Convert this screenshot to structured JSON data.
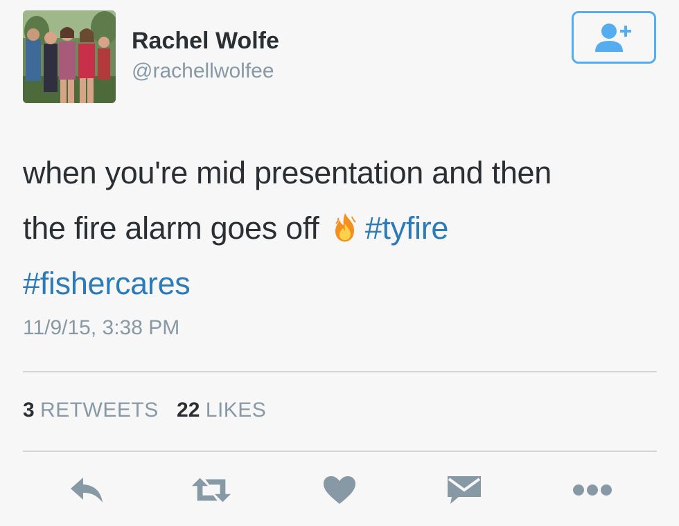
{
  "user": {
    "display_name": "Rachel Wolfe",
    "handle": "@rachellwolfee"
  },
  "follow_button": {
    "icon": "add-user-icon"
  },
  "tweet": {
    "text_line1": "when you're mid presentation and then",
    "text_line2_prefix": "the fire alarm goes off",
    "emoji": "fire-icon",
    "hashtag1": "#tyfire",
    "hashtag2": "#fishercares",
    "timestamp": "11/9/15, 3:38 PM"
  },
  "stats": {
    "retweets_count": "3",
    "retweets_label": "RETWEETS",
    "likes_count": "22",
    "likes_label": "LIKES"
  },
  "actions": [
    {
      "name": "reply",
      "icon": "reply-icon"
    },
    {
      "name": "retweet",
      "icon": "retweet-icon"
    },
    {
      "name": "like",
      "icon": "heart-icon"
    },
    {
      "name": "direct-message",
      "icon": "envelope-icon"
    },
    {
      "name": "more",
      "icon": "more-icon"
    }
  ],
  "colors": {
    "link": "#2b7bb9",
    "muted": "#8899a6",
    "text": "#292f33",
    "accent": "#55acee",
    "icon": "#8899a6"
  }
}
